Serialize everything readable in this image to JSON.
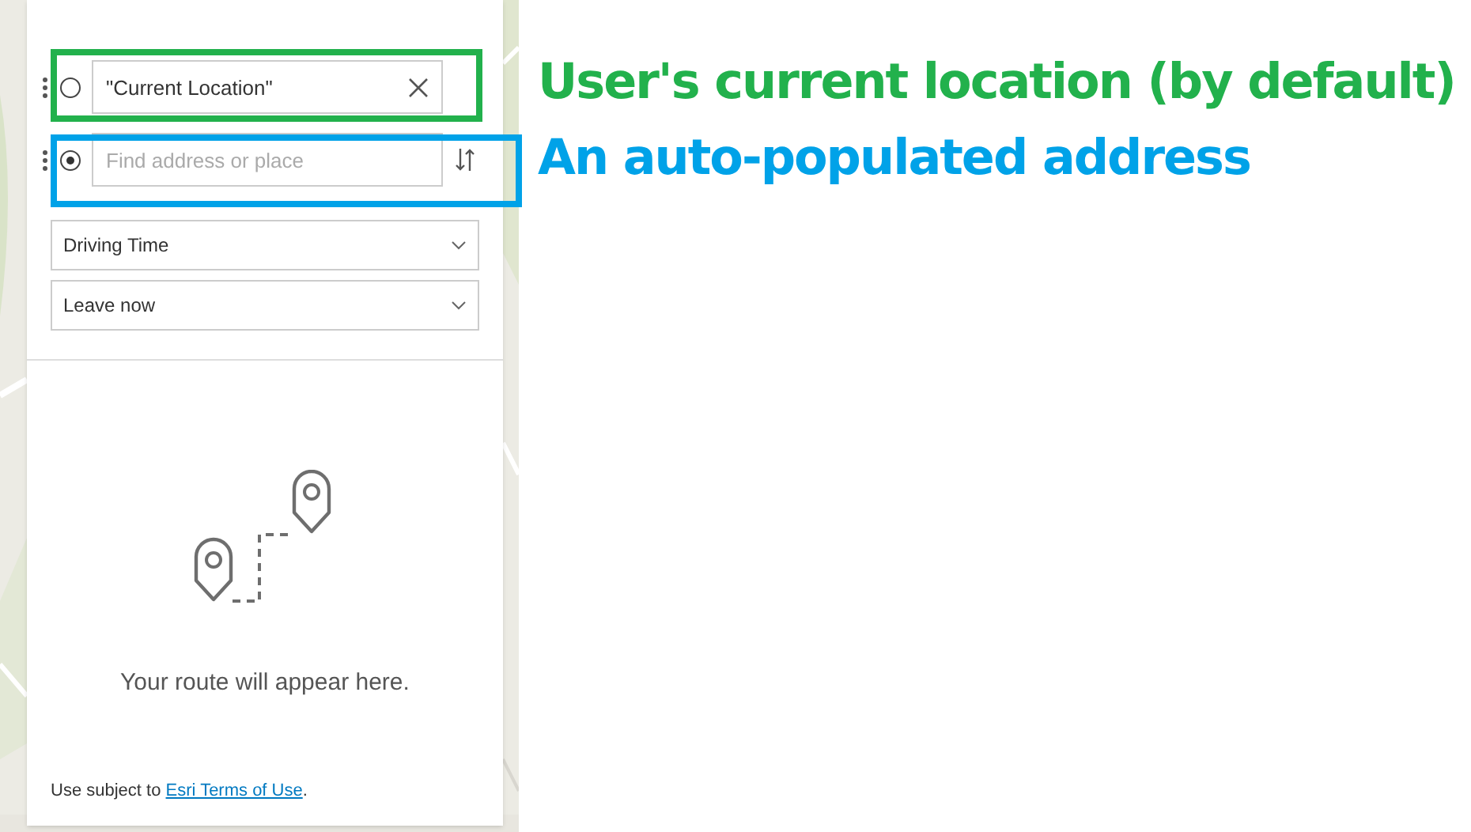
{
  "stops": [
    {
      "value": "\"Current Location\"",
      "selected": false,
      "color": "#22b14c"
    },
    {
      "placeholder": "Find address or place",
      "selected": true,
      "color": "#00a2e8"
    }
  ],
  "travel_mode": "Driving Time",
  "departure": "Leave now",
  "empty_message": "Your route will appear here.",
  "footer": {
    "text": "Use subject to ",
    "link": "Esri Terms of Use",
    "suffix": "."
  },
  "annotations": [
    {
      "text": "User's current location (by default)",
      "color": "#22b14c"
    },
    {
      "text": "An auto-populated address",
      "color": "#00a2e8"
    }
  ]
}
